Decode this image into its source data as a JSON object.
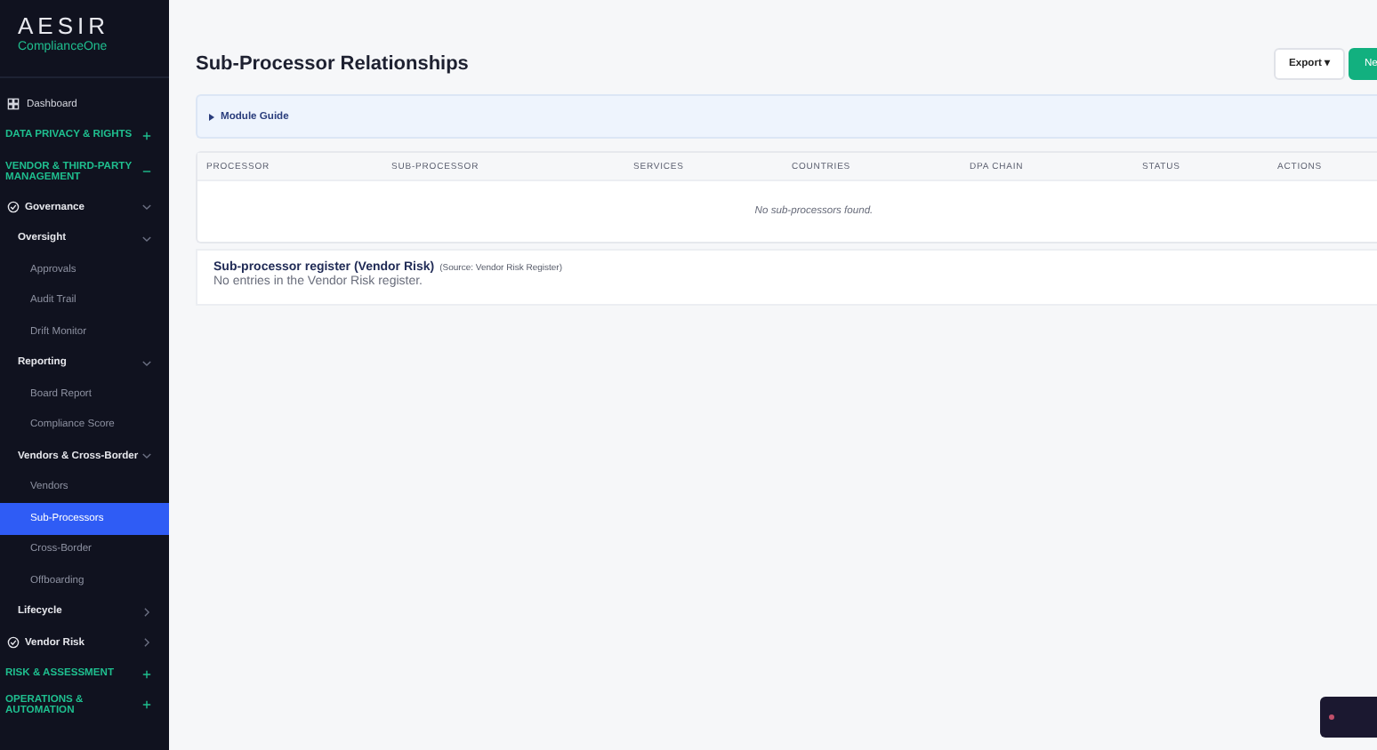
{
  "sidebar": {
    "logo": {
      "name": "AESIR",
      "tagline": "ComplianceOne"
    },
    "items": [
      {
        "kind": "link",
        "label": "Dashboard"
      },
      {
        "kind": "section",
        "label": "DATA PRIVACY & RIGHTS",
        "expanded": false
      },
      {
        "kind": "section",
        "label": "VENDOR & THIRD-PARTY MANAGEMENT",
        "expanded": true,
        "children": [
          {
            "kind": "group",
            "label": "Governance",
            "expanded": true,
            "children": [
              {
                "kind": "subgroup",
                "label": "Oversight",
                "expanded": true,
                "children": [
                  {
                    "kind": "page",
                    "label": "Approvals",
                    "selected": false
                  },
                  {
                    "kind": "page",
                    "label": "Audit Trail",
                    "selected": false
                  },
                  {
                    "kind": "page",
                    "label": "Drift Monitor",
                    "selected": false
                  }
                ]
              },
              {
                "kind": "subgroup",
                "label": "Reporting",
                "expanded": true,
                "children": [
                  {
                    "kind": "page",
                    "label": "Board Report",
                    "selected": false
                  },
                  {
                    "kind": "page",
                    "label": "Compliance Score",
                    "selected": false
                  }
                ]
              },
              {
                "kind": "subgroup",
                "label": "Vendors & Cross-Border",
                "expanded": true,
                "children": [
                  {
                    "kind": "page",
                    "label": "Vendors",
                    "selected": false
                  },
                  {
                    "kind": "page",
                    "label": "Sub-Processors",
                    "selected": true
                  },
                  {
                    "kind": "page",
                    "label": "Cross-Border",
                    "selected": false
                  },
                  {
                    "kind": "page",
                    "label": "Offboarding",
                    "selected": false
                  }
                ]
              },
              {
                "kind": "subgroup",
                "label": "Lifecycle",
                "expanded": false
              }
            ]
          },
          {
            "kind": "group",
            "label": "Vendor Risk",
            "expanded": false
          }
        ]
      },
      {
        "kind": "section",
        "label": "RISK & ASSESSMENT",
        "expanded": false
      },
      {
        "kind": "section",
        "label": "OPERATIONS & AUTOMATION",
        "expanded": false
      }
    ]
  },
  "header": {
    "title": "Sub-Processor Relationships",
    "buttons": [
      {
        "kind": "secondary",
        "label": "Export ▾"
      },
      {
        "kind": "primary",
        "label": "Ne"
      }
    ]
  },
  "module_guide": {
    "label": "Module Guide",
    "expanded": false
  },
  "table": {
    "columns": [
      "PROCESSOR",
      "SUB-PROCESSOR",
      "SERVICES",
      "COUNTRIES",
      "DPA CHAIN",
      "STATUS",
      "ACTIONS"
    ],
    "empty_message": "No sub-processors found."
  },
  "register": {
    "title": "Sub-processor register (Vendor Risk)",
    "source": "(Source: Vendor Risk Register)",
    "empty_message": "No entries in the Vendor Risk register."
  }
}
